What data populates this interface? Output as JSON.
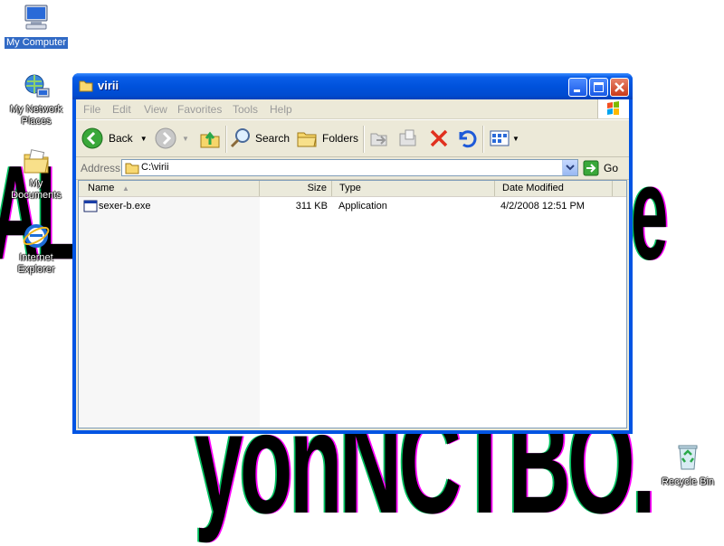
{
  "desktop": {
    "background_text": [
      "AL",
      "oe",
      "yonNCTBO."
    ],
    "icons": [
      {
        "label": "My Computer",
        "icon": "my-computer-icon",
        "selected": true
      },
      {
        "label": "My Network Places",
        "icon": "network-places-icon"
      },
      {
        "label": "My Documents",
        "icon": "my-documents-icon"
      },
      {
        "label": "Internet Explorer",
        "icon": "internet-explorer-icon"
      },
      {
        "label": "Recycle Bin",
        "icon": "recycle-bin-icon"
      }
    ]
  },
  "window": {
    "title": "virii",
    "menu": [
      "File",
      "Edit",
      "View",
      "Favorites",
      "Tools",
      "Help"
    ],
    "toolbar": {
      "back": "Back",
      "search": "Search",
      "folders": "Folders"
    },
    "address": {
      "label": "Address",
      "value": "C:\\virii",
      "go": "Go"
    },
    "columns": [
      "Name",
      "Size",
      "Type",
      "Date Modified"
    ],
    "files": [
      {
        "name": "sexer-b.exe",
        "size": "311 KB",
        "type": "Application",
        "modified": "4/2/2008 12:51 PM"
      }
    ]
  },
  "colors": {
    "titlebar": "#0054e3",
    "selection": "#316ac5",
    "window_face": "#ece9d8"
  }
}
